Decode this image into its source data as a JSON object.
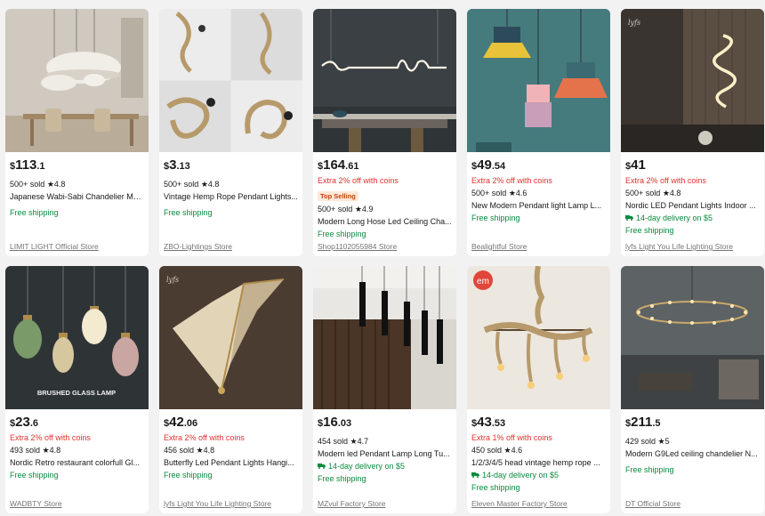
{
  "products": [
    {
      "price_currency": "$",
      "price_main": "113",
      "price_cents": ".1",
      "promo": "",
      "badge": "",
      "sold": "500+ sold",
      "rating": "4.8",
      "title": "Japanese Wabi-Sabi Chandelier Mo...",
      "delivery": "",
      "shipping": "Free shipping",
      "store": "LIMIT LIGHT Official Store",
      "image": "white-pebble-pendants-dining-room"
    },
    {
      "price_currency": "$",
      "price_main": "3",
      "price_cents": ".13",
      "promo": "",
      "badge": "",
      "sold": "500+ sold",
      "rating": "4.8",
      "title": "Vintage Hemp Rope Pendant Lights...",
      "delivery": "",
      "shipping": "Free shipping",
      "store": "ZBO-Lightings Store",
      "image": "hemp-rope-pendants"
    },
    {
      "price_currency": "$",
      "price_main": "164",
      "price_cents": ".61",
      "promo": "Extra 2% off with coins",
      "badge": "Top Selling",
      "sold": "500+ sold",
      "rating": "4.9",
      "title": "Modern Long Hose Led Ceiling Cha...",
      "delivery": "",
      "shipping": "Free shipping",
      "store": "Shop1102055984 Store",
      "image": "long-hose-led-over-table"
    },
    {
      "price_currency": "$",
      "price_main": "49",
      "price_cents": ".54",
      "promo": "Extra 2% off with coins",
      "badge": "",
      "sold": "500+ sold",
      "rating": "4.6",
      "title": "New Modern Pendant light Lamp L...",
      "delivery": "",
      "shipping": "Free shipping",
      "store": "Bealightful Store",
      "image": "colorful-pendant-lamps"
    },
    {
      "price_currency": "$",
      "price_main": "41",
      "price_cents": "",
      "promo": "Extra 2% off with coins",
      "badge": "",
      "sold": "500+ sold",
      "rating": "4.8",
      "title": "Nordic LED Pendant Lights Indoor ...",
      "delivery": "14-day delivery on $5",
      "shipping": "Free shipping",
      "store": "lyfs Light You Life Lighting Store",
      "image": "spiral-led-pendant"
    },
    {
      "price_currency": "$",
      "price_main": "23",
      "price_cents": ".6",
      "promo": "Extra 2% off with coins",
      "badge": "",
      "sold": "493 sold",
      "rating": "4.8",
      "title": "Nordic Retro restaurant colorfull Gl...",
      "delivery": "",
      "shipping": "Free shipping",
      "store": "WADBTY Store",
      "image": "brushed-glass-lamps",
      "overlay_text": "BRUSHED GLASS LAMP"
    },
    {
      "price_currency": "$",
      "price_main": "42",
      "price_cents": ".06",
      "promo": "Extra 2% off with coins",
      "badge": "",
      "sold": "456 sold",
      "rating": "4.8",
      "title": "Butterfly Led Pendant Lights Hangi...",
      "delivery": "",
      "shipping": "Free shipping",
      "store": "lyfs Light You Life Lighting Store",
      "image": "butterfly-crystal-pendant"
    },
    {
      "price_currency": "$",
      "price_main": "16",
      "price_cents": ".03",
      "promo": "",
      "badge": "",
      "sold": "454 sold",
      "rating": "4.7",
      "title": "Modern led Pendant Lamp Long Tu...",
      "delivery": "14-day delivery on $5",
      "shipping": "Free shipping",
      "store": "MZvul Factory Store",
      "image": "black-tube-pendants"
    },
    {
      "price_currency": "$",
      "price_main": "43",
      "price_cents": ".53",
      "promo": "Extra 1% off with coins",
      "badge": "",
      "sold": "450 sold",
      "rating": "4.6",
      "title": "1/2/3/4/5 head vintage hemp rope ...",
      "delivery": "14-day delivery on $5",
      "shipping": "Free shipping",
      "store": "Eleven Master Factory Store",
      "image": "hemp-rope-multi-head"
    },
    {
      "price_currency": "$",
      "price_main": "211",
      "price_cents": ".5",
      "promo": "",
      "badge": "",
      "sold": "429 sold",
      "rating": "5",
      "title": "Modern G9Led ceiling chandelier N...",
      "delivery": "",
      "shipping": "Free shipping",
      "store": "DT Official Store",
      "image": "ring-chandelier-living-room"
    }
  ],
  "colors": {
    "promo": "#e0312d",
    "shipping": "#0a8a3e",
    "store": "#757575",
    "badge_bg": "#fde8d6",
    "badge_text": "#c2430a"
  },
  "icons": {
    "star": "★",
    "truck": "truck-icon"
  }
}
